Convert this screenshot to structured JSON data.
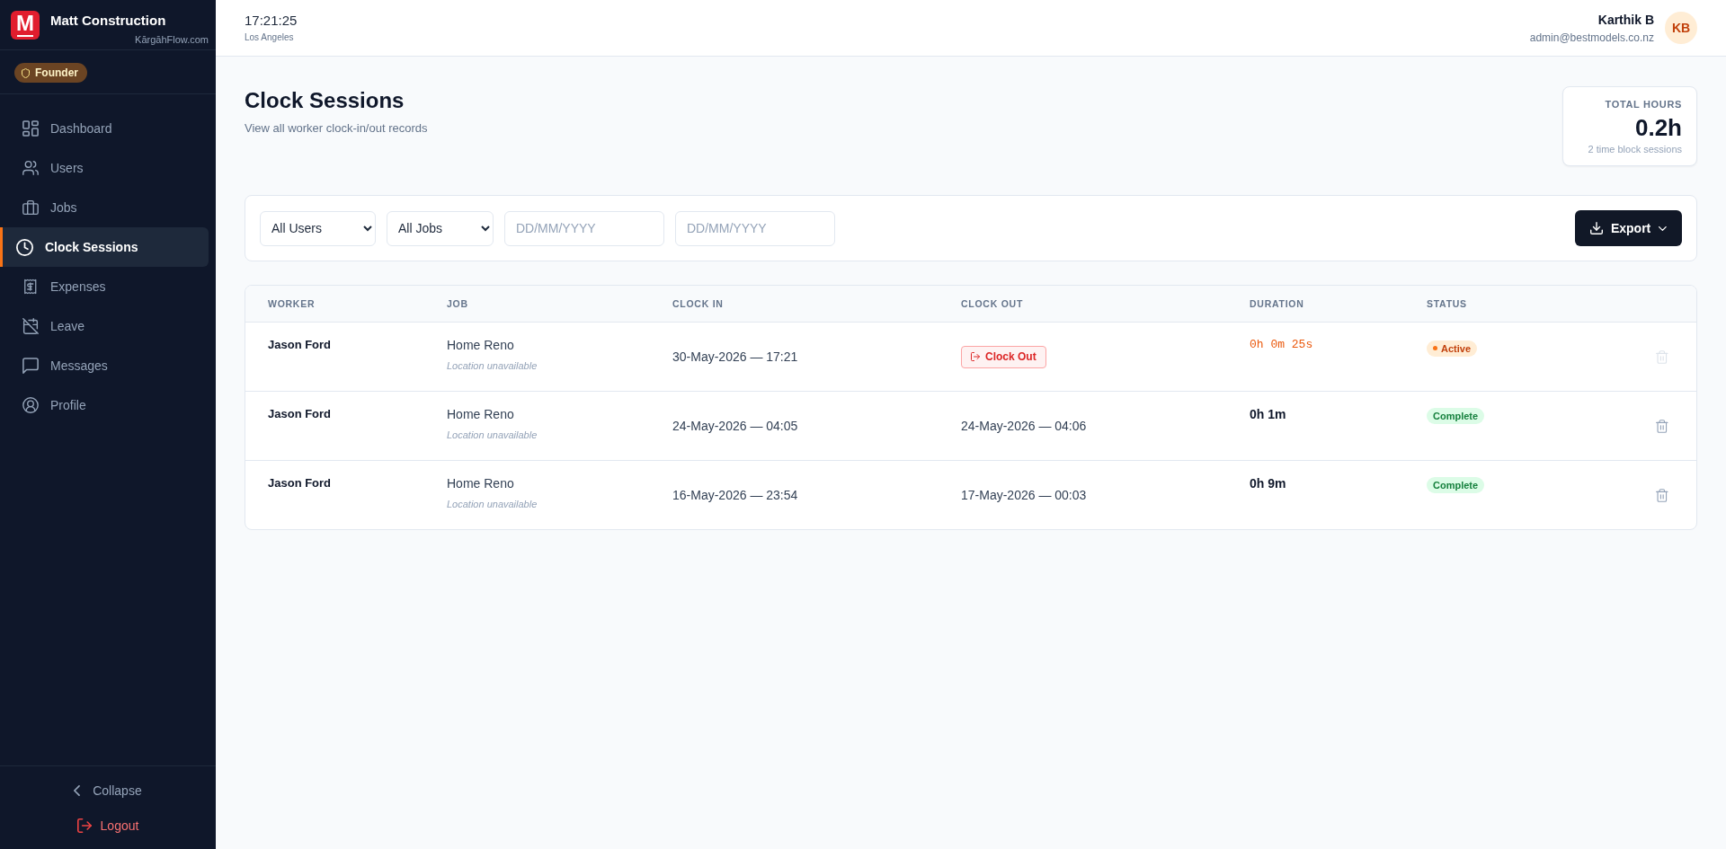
{
  "sidebar": {
    "logo_letter": "M",
    "brand_name": "Matt Construction",
    "brand_domain": "KārgāhFlow.com",
    "role_badge": "Founder",
    "nav": [
      {
        "label": "Dashboard",
        "selected": false
      },
      {
        "label": "Users",
        "selected": false
      },
      {
        "label": "Jobs",
        "selected": false
      },
      {
        "label": "Clock Sessions",
        "selected": true
      },
      {
        "label": "Expenses",
        "selected": false
      },
      {
        "label": "Leave",
        "selected": false
      },
      {
        "label": "Messages",
        "selected": false
      },
      {
        "label": "Profile",
        "selected": false
      }
    ],
    "collapse_button": "Collapse",
    "logout_button": "Logout"
  },
  "header": {
    "time": "17:21:25",
    "timezone": "Los Angeles",
    "user_name": "Karthik B",
    "user_email": "admin@bestmodels.co.nz",
    "avatar_initials": "KB"
  },
  "page": {
    "title": "Clock Sessions",
    "subtitle": "View all worker clock-in/out records"
  },
  "summary_card": {
    "label": "TOTAL HOURS",
    "value": "0.2h",
    "note": "2 time block sessions"
  },
  "filters": {
    "user_select": "All Users",
    "job_select": "All Jobs",
    "date_from": {
      "placeholder": "DD/MM/YYYY"
    },
    "date_to": {
      "placeholder": "DD/MM/YYYY"
    },
    "export_button": "Export"
  },
  "table": {
    "columns": [
      "WORKER",
      "JOB",
      "CLOCK IN",
      "CLOCK OUT",
      "DURATION",
      "STATUS"
    ],
    "rows": [
      {
        "worker": "Jason Ford",
        "job": "Home Reno",
        "location": "Location unavailable",
        "clock_in": "30-May-2026 — 17:21",
        "clock_out": {
          "kind": "button",
          "text": "Clock Out"
        },
        "duration": "0h 0m 25s",
        "status": {
          "kind": "active",
          "label": "Active"
        },
        "delete_disabled": true
      },
      {
        "worker": "Jason Ford",
        "job": "Home Reno",
        "location": "Location unavailable",
        "clock_in": "24-May-2026 — 04:05",
        "clock_out": {
          "kind": "time",
          "text": "24-May-2026 — 04:06"
        },
        "duration": "0h 1m",
        "status": {
          "kind": "complete",
          "label": "Complete"
        },
        "delete_disabled": false
      },
      {
        "worker": "Jason Ford",
        "job": "Home Reno",
        "location": "Location unavailable",
        "clock_in": "16-May-2026 — 23:54",
        "clock_out": {
          "kind": "time",
          "text": "17-May-2026 — 00:03"
        },
        "duration": "0h 9m",
        "status": {
          "kind": "complete",
          "label": "Complete"
        },
        "delete_disabled": false
      }
    ]
  }
}
